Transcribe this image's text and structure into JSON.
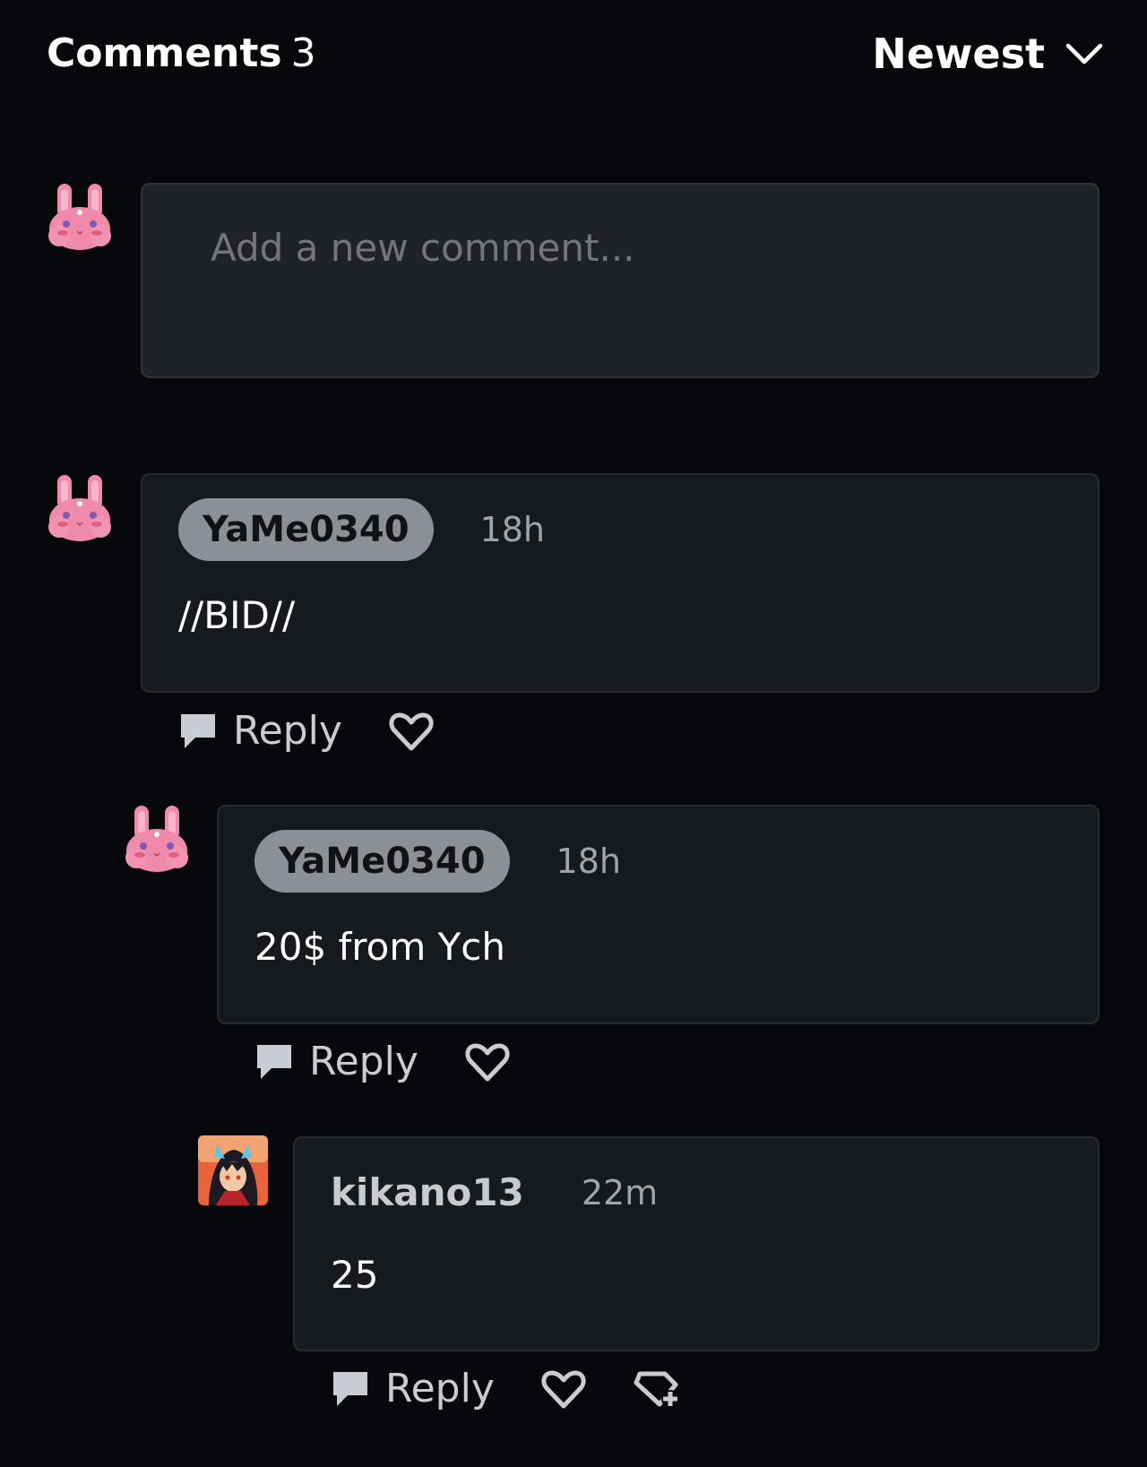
{
  "header": {
    "title": "Comments",
    "count": "3",
    "sort_label": "Newest"
  },
  "composer": {
    "placeholder": "Add a new comment..."
  },
  "comments": [
    {
      "username": "YaMe0340",
      "time": "18h",
      "text": "//BID//",
      "reply_label": "Reply",
      "avatar": "pink-bunny-avatar"
    },
    {
      "username": "YaMe0340",
      "time": "18h",
      "text": "20$ from Ych",
      "reply_label": "Reply",
      "avatar": "pink-bunny-avatar"
    },
    {
      "username": "kikano13",
      "time": "22m",
      "text": "25",
      "reply_label": "Reply",
      "avatar": "character-portrait-avatar"
    }
  ],
  "colors": {
    "background": "#07080c",
    "card": "#16191d",
    "input": "#1f2226",
    "pill": "#8d8f96",
    "secondary_text": "#9fa3aa",
    "bunny_pink": "#f08aaa"
  },
  "icons": {
    "sort": "chevron-down-icon",
    "reply": "speech-bubble-icon",
    "like": "heart-icon",
    "extra": "tag-plus-icon"
  }
}
